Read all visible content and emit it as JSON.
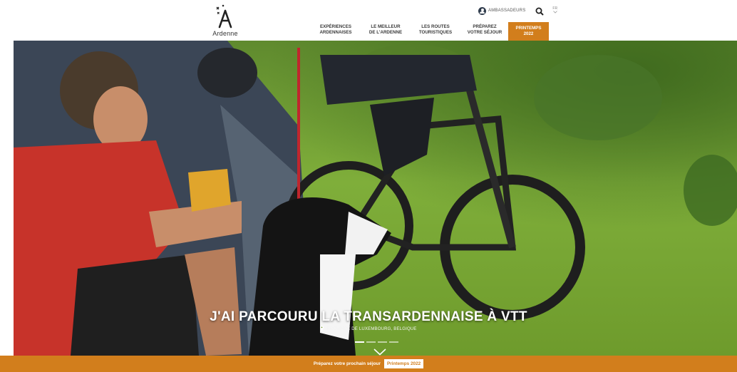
{
  "header": {
    "logo_text": "Ardenne",
    "ambassadors_label": "AMBASSADEURS",
    "lang_label": "FR",
    "nav": [
      {
        "line1": "EXPÉRIENCES",
        "line2": "ARDENNAISES"
      },
      {
        "line1": "LE MEILLEUR",
        "line2": "DE L'ARDENNE"
      },
      {
        "line1": "LES ROUTES",
        "line2": "TOURISTIQUES"
      },
      {
        "line1": "PRÉPAREZ",
        "line2": "VOTRE SÉJOUR"
      }
    ],
    "cta": {
      "line1": "PRINTEMPS",
      "line2": "2022"
    }
  },
  "hero": {
    "title": "J'AI PARCOURU LA TRANSARDENNAISE À VTT",
    "location": "PROVINCE DE LUXEMBOURG, BELGIQUE",
    "slide_count": 4,
    "active_slide": 1
  },
  "bar": {
    "text": "Préparez votre prochain séjour",
    "button": "Printemps 2022"
  },
  "colors": {
    "accent": "#d27e1c",
    "nav_text": "#3a3a3a"
  },
  "icons": {
    "user": "user-circle-icon",
    "search": "search-icon",
    "pin": "map-pin-icon",
    "scroll": "chevron-down-icon"
  }
}
